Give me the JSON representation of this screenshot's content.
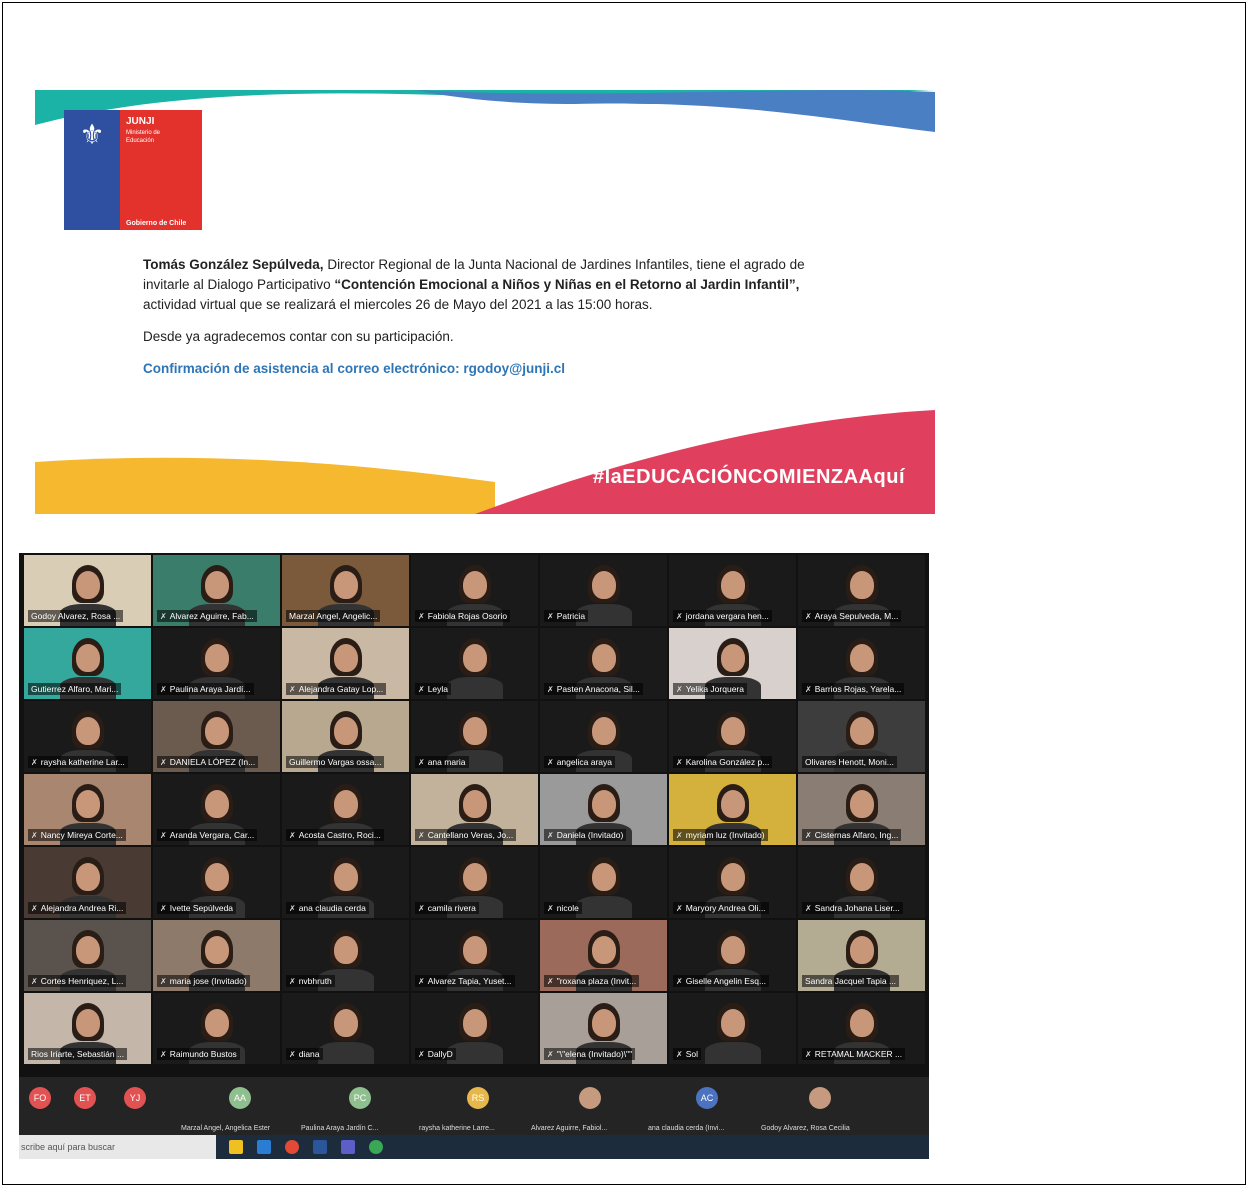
{
  "invitation": {
    "logo": {
      "brand": "JUNJI",
      "ministry": "Ministerio de Educación",
      "government": "Gobierno de Chile"
    },
    "paragraph1": {
      "name_bold": "Tomás González Sepúlveda,",
      "part1": " Director Regional de la Junta Nacional de Jardines Infantiles, tiene el agrado de invitarle al Dialogo Participativo ",
      "title_bold": "“Contención Emocional a Niños y Niñas en el Retorno al Jardin Infantil”,",
      "part2": " actividad virtual que se realizará el miercoles 26 de Mayo del 2021 a las 15:00 horas."
    },
    "paragraph2": "Desde ya agradecemos contar con su participación.",
    "confirmation": "Confirmación de asistencia al correo electrónico: rgodoy@junji.cl",
    "hashtag": "#laEDUCACIÓNCOMIENZAAquí",
    "colors": {
      "teal": "#1bb3a6",
      "blue": "#4a7fc4",
      "yellow": "#f5b82e",
      "pink": "#e0405e",
      "link_blue": "#2e75b6"
    }
  },
  "meeting": {
    "participants": [
      {
        "name": "Godoy Alvarez, Rosa ...",
        "mic": false,
        "bg": "#d9cdb6"
      },
      {
        "name": "Alvarez Aguirre, Fab...",
        "mic": true,
        "bg": "#3a7d6b"
      },
      {
        "name": "Marzal Angel, Angelic...",
        "mic": false,
        "bg": "#7a5a3a"
      },
      {
        "name": "Fabiola Rojas Osorio",
        "mic": true,
        "bg": "#1a1a1a"
      },
      {
        "name": "Patricia",
        "mic": true,
        "bg": "#1a1a1a"
      },
      {
        "name": "jordana vergara hen...",
        "mic": true,
        "bg": "#1a1a1a"
      },
      {
        "name": "Araya Sepulveda, M...",
        "mic": true,
        "bg": "#1a1a1a"
      },
      {
        "name": "Gutierrez Alfaro, Mari...",
        "mic": false,
        "bg": "#34a89c"
      },
      {
        "name": "Paulina Araya Jardí...",
        "mic": true,
        "bg": "#1a1a1a"
      },
      {
        "name": "Alejandra Gatay Lop...",
        "mic": true,
        "bg": "#c9b8a3"
      },
      {
        "name": "Leyla",
        "mic": true,
        "bg": "#1a1a1a"
      },
      {
        "name": "Pasten Anacona, Sil...",
        "mic": true,
        "bg": "#1a1a1a"
      },
      {
        "name": "Yelika Jorquera",
        "mic": true,
        "bg": "#d8d0cc"
      },
      {
        "name": "Barrios Rojas, Yarela...",
        "mic": true,
        "bg": "#1a1a1a"
      },
      {
        "name": "raysha katherine Lar...",
        "mic": true,
        "bg": "#1a1a1a"
      },
      {
        "name": "DANIELA LÓPEZ (In...",
        "mic": true,
        "bg": "#6b5a4e"
      },
      {
        "name": "Guillermo Vargas ossa...",
        "mic": false,
        "bg": "#b8a890"
      },
      {
        "name": "ana maria",
        "mic": true,
        "bg": "#1a1a1a"
      },
      {
        "name": "angelica araya",
        "mic": true,
        "bg": "#1a1a1a"
      },
      {
        "name": "Karolina González p...",
        "mic": true,
        "bg": "#1a1a1a"
      },
      {
        "name": "Olivares Henott, Moni...",
        "mic": false,
        "bg": "#3d3d3d"
      },
      {
        "name": "Nancy Mireya Corte...",
        "mic": true,
        "bg": "#a88670"
      },
      {
        "name": "Aranda Vergara, Car...",
        "mic": true,
        "bg": "#1a1a1a"
      },
      {
        "name": "Acosta Castro, Roci...",
        "mic": true,
        "bg": "#1a1a1a"
      },
      {
        "name": "Cantellano Veras, Jo...",
        "mic": true,
        "bg": "#c2b29c"
      },
      {
        "name": "Daniela (Invitado)",
        "mic": true,
        "bg": "#9a9a9a"
      },
      {
        "name": "myriam luz (Invitado)",
        "mic": true,
        "bg": "#d4b13c"
      },
      {
        "name": "Cisternas Alfaro, Ing...",
        "mic": true,
        "bg": "#8a7e74"
      },
      {
        "name": "Alejandra Andrea Ri...",
        "mic": true,
        "bg": "#4a3a34"
      },
      {
        "name": "Ivette Sepúlveda",
        "mic": true,
        "bg": "#1a1a1a"
      },
      {
        "name": "ana claudia cerda",
        "mic": true,
        "bg": "#1a1a1a"
      },
      {
        "name": "camila rivera",
        "mic": true,
        "bg": "#1a1a1a"
      },
      {
        "name": "nicole",
        "mic": true,
        "bg": "#1a1a1a"
      },
      {
        "name": "Maryory Andrea Oli...",
        "mic": true,
        "bg": "#1a1a1a"
      },
      {
        "name": "Sandra Johana Liser...",
        "mic": true,
        "bg": "#1a1a1a"
      },
      {
        "name": "Cortes Henriquez, L...",
        "mic": true,
        "bg": "#5a524c"
      },
      {
        "name": "maria jose (Invitado)",
        "mic": true,
        "bg": "#8e7a6a"
      },
      {
        "name": "nvbhruth",
        "mic": true,
        "bg": "#1a1a1a"
      },
      {
        "name": "Alvarez Tapia, Yuset...",
        "mic": true,
        "bg": "#1a1a1a"
      },
      {
        "name": "\"roxana plaza (Invit...",
        "mic": true,
        "bg": "#9c6a5a"
      },
      {
        "name": "Giselle Angelin Esq...",
        "mic": true,
        "bg": "#1a1a1a"
      },
      {
        "name": "Sandra Jacquel Tapia ...",
        "mic": false,
        "bg": "#b3ab92"
      },
      {
        "name": "Rios Iriarte, Sebastián ...",
        "mic": false,
        "bg": "#c4b7aa"
      },
      {
        "name": "Raimundo Bustos",
        "mic": true,
        "bg": "#1a1a1a"
      },
      {
        "name": "diana",
        "mic": true,
        "bg": "#1a1a1a"
      },
      {
        "name": "DallyD",
        "mic": true,
        "bg": "#1a1a1a"
      },
      {
        "name": "\"\\\"elena (Invitado)\\\"\"",
        "mic": true,
        "bg": "#a8a098"
      },
      {
        "name": "Sol",
        "mic": true,
        "bg": "#1a1a1a"
      },
      {
        "name": "RETAMAL MACKER ...",
        "mic": true,
        "bg": "#1a1a1a"
      }
    ],
    "bottom_bar": [
      {
        "initials": "FO",
        "label": "",
        "style": "red"
      },
      {
        "initials": "ET",
        "label": "",
        "style": "red"
      },
      {
        "initials": "YJ",
        "label": "",
        "style": "red"
      },
      {
        "initials": "AA",
        "label": "Marzal Angel, Angelica Ester",
        "style": "green"
      },
      {
        "initials": "PC",
        "label": "Paulina Araya Jardín C...",
        "style": "green"
      },
      {
        "initials": "RS",
        "label": "raysha katherine Larre...",
        "style": "gold"
      },
      {
        "initials": "",
        "label": "Alvarez Aguirre, Fabiol...",
        "style": "photo-av"
      },
      {
        "initials": "AC",
        "label": "ana claudia cerda (Invi...",
        "style": "blue"
      },
      {
        "initials": "",
        "label": "Godoy Alvarez, Rosa Cecilia",
        "style": "photo-av"
      }
    ],
    "taskbar_search": "scribe aquí para buscar"
  }
}
